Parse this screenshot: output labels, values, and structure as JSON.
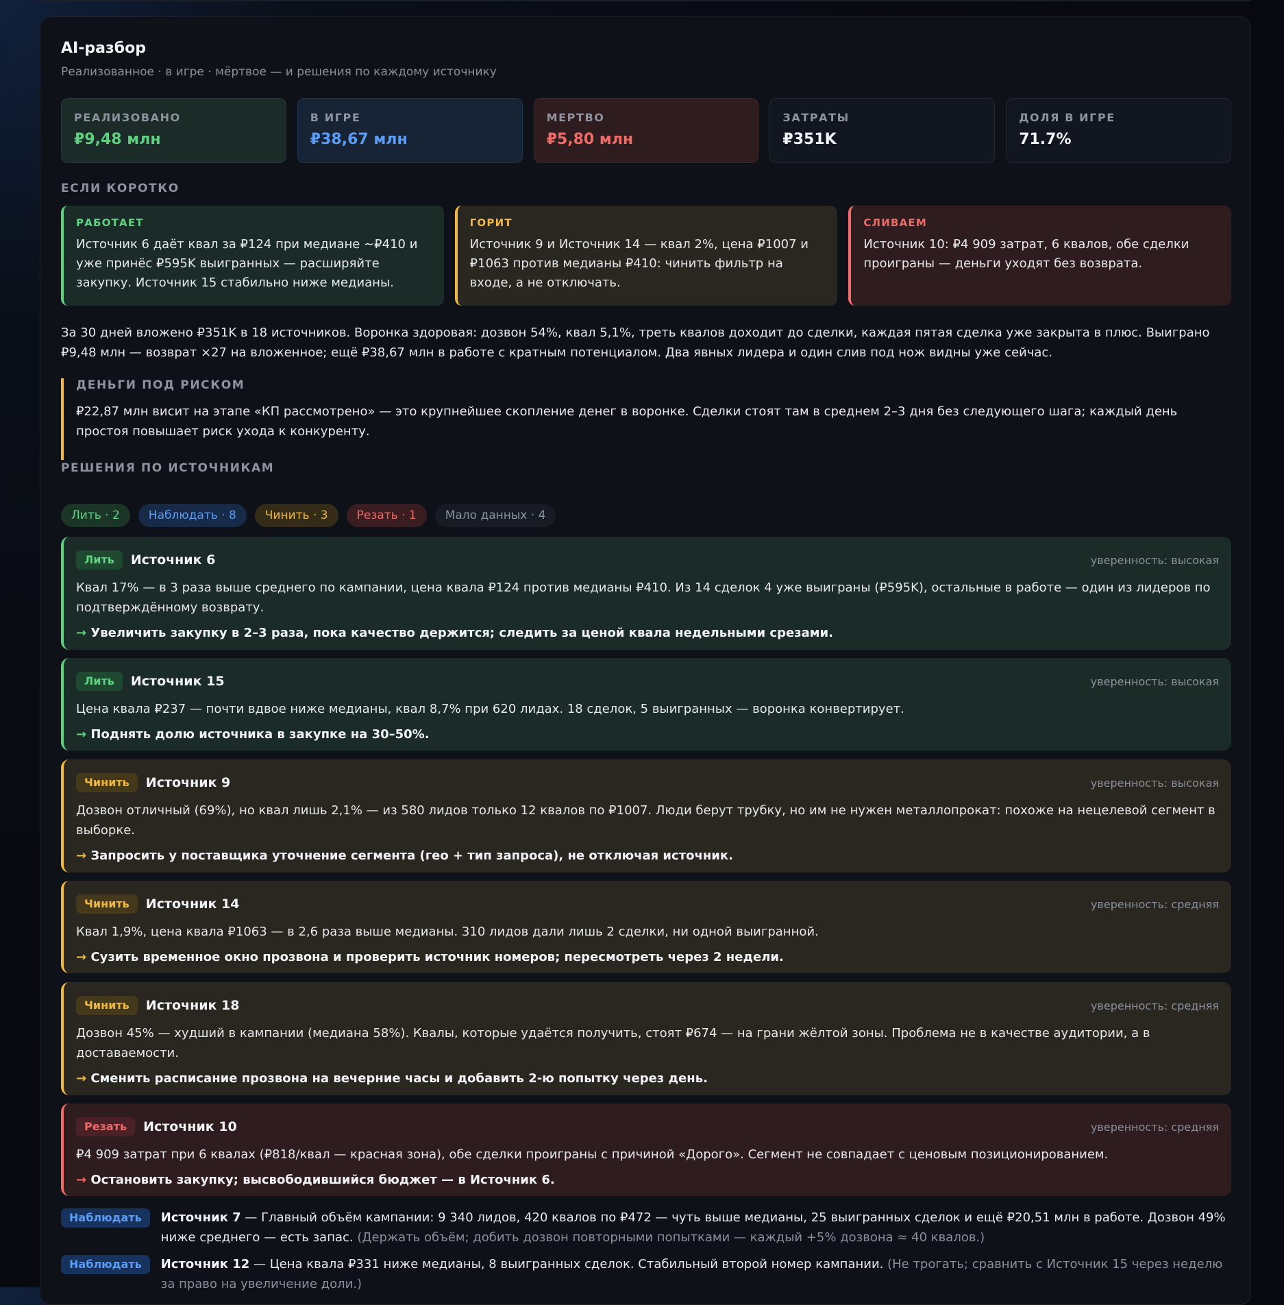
{
  "header": {
    "title": "AI-разбор",
    "subtitle": "Реализованное · в игре · мёртвое — и решения по каждому источнику"
  },
  "kpis": [
    {
      "label": "РЕАЛИЗОВАНО",
      "value": "₽9,48 млн",
      "tone": "green"
    },
    {
      "label": "В ИГРЕ",
      "value": "₽38,67 млн",
      "tone": "blue"
    },
    {
      "label": "МЕРТВО",
      "value": "₽5,80 млн",
      "tone": "red"
    },
    {
      "label": "ЗАТРАТЫ",
      "value": "₽351K",
      "tone": "plain"
    },
    {
      "label": "ДОЛЯ В ИГРЕ",
      "value": "71.7%",
      "tone": "plain"
    }
  ],
  "brief": {
    "heading": "ЕСЛИ КОРОТКО",
    "items": [
      {
        "label": "РАБОТАЕТ",
        "text": "Источник 6 даёт квал за ₽124 при медиане ~₽410 и уже принёс ₽595K выигранных — расширяйте закупку. Источник 15 стабильно ниже медианы."
      },
      {
        "label": "ГОРИТ",
        "text": "Источник 9 и Источник 14 — квал 2%, цена ₽1007 и ₽1063 против медианы ₽410: чинить фильтр на входе, а не отключать."
      },
      {
        "label": "СЛИВАЕМ",
        "text": "Источник 10: ₽4 909 затрат, 6 квалов, обе сделки проиграны — деньги уходят без возврата."
      }
    ]
  },
  "summary": "За 30 дней вложено ₽351K в 18 источников. Воронка здоровая: дозвон 54%, квал 5,1%, треть квалов доходит до сделки, каждая пятая сделка уже закрыта в плюс. Выиграно ₽9,48 млн — возврат ×27 на вложенное; ещё ₽38,67 млн в работе с кратным потенциалом. Два явных лидера и один слив под нож видны уже сейчас.",
  "risk": {
    "heading": "ДЕНЬГИ ПОД РИСКОМ",
    "text": "₽22,87 млн висит на этапе «КП рассмотрено» — это крупнейшее скопление денег в воронке. Сделки стоят там в среднем 2–3 дня без следующего шага; каждый день простоя повышает риск ухода к конкуренту."
  },
  "decisions": {
    "heading": "РЕШЕНИЯ ПО ИСТОЧНИКАМ",
    "filters": [
      {
        "label": "Лить · 2"
      },
      {
        "label": "Наблюдать · 8"
      },
      {
        "label": "Чинить · 3"
      },
      {
        "label": "Резать · 1"
      },
      {
        "label": "Мало данных · 4"
      }
    ],
    "cards": [
      {
        "badge": "Лить",
        "name": "Источник 6",
        "confidence": "уверенность: высокая",
        "text": "Квал 17% — в 3 раза выше среднего по кампании, цена квала ₽124 против медианы ₽410. Из 14 сделок 4 уже выиграны (₽595K), остальные в работе — один из лидеров по подтверждённому возврату.",
        "arrow": "→",
        "action": "Увеличить закупку в 2–3 раза, пока качество держится; следить за ценой квала недельными срезами."
      },
      {
        "badge": "Лить",
        "name": "Источник 15",
        "confidence": "уверенность: высокая",
        "text": "Цена квала ₽237 — почти вдвое ниже медианы, квал 8,7% при 620 лидах. 18 сделок, 5 выигранных — воронка конвертирует.",
        "arrow": "→",
        "action": "Поднять долю источника в закупке на 30–50%."
      },
      {
        "badge": "Чинить",
        "name": "Источник 9",
        "confidence": "уверенность: высокая",
        "text": "Дозвон отличный (69%), но квал лишь 2,1% — из 580 лидов только 12 квалов по ₽1007. Люди берут трубку, но им не нужен металлопрокат: похоже на нецелевой сегмент в выборке.",
        "arrow": "→",
        "action": "Запросить у поставщика уточнение сегмента (гео + тип запроса), не отключая источник."
      },
      {
        "badge": "Чинить",
        "name": "Источник 14",
        "confidence": "уверенность: средняя",
        "text": "Квал 1,9%, цена квала ₽1063 — в 2,6 раза выше медианы. 310 лидов дали лишь 2 сделки, ни одной выигранной.",
        "arrow": "→",
        "action": "Сузить временное окно прозвона и проверить источник номеров; пересмотреть через 2 недели."
      },
      {
        "badge": "Чинить",
        "name": "Источник 18",
        "confidence": "уверенность: средняя",
        "text": "Дозвон 45% — худший в кампании (медиана 58%). Квалы, которые удаётся получить, стоят ₽674 — на грани жёлтой зоны. Проблема не в качестве аудитории, а в доставаемости.",
        "arrow": "→",
        "action": "Сменить расписание прозвона на вечерние часы и добавить 2-ю попытку через день."
      },
      {
        "badge": "Резать",
        "name": "Источник 10",
        "confidence": "уверенность: средняя",
        "text": "₽4 909 затрат при 6 квалах (₽818/квал — красная зона), обе сделки проиграны с причиной «Дорого». Сегмент не совпадает с ценовым позиционированием.",
        "arrow": "→",
        "action": "Остановить закупку; высвободившийся бюджет — в Источник 6."
      }
    ],
    "watch": [
      {
        "badge": "Наблюдать",
        "name": "Источник 7",
        "sep": " — ",
        "text": "Главный объём кампании: 9 340 лидов, 420 квалов по ₽472 — чуть выше медианы, 25 выигранных сделок и ещё ₽20,51 млн в работе. Дозвон 49% ниже среднего — есть запас.",
        "note": " (Держать объём; добить дозвон повторными попытками — каждый +5% дозвона ≈ 40 квалов.)"
      },
      {
        "badge": "Наблюдать",
        "name": "Источник 12",
        "sep": " — ",
        "text": "Цена квала ₽331 ниже медианы, 8 выигранных сделок. Стабильный второй номер кампании.",
        "note": " (Не трогать; сравнить с Источник 15 через неделю за право на увеличение доли.)"
      }
    ]
  }
}
